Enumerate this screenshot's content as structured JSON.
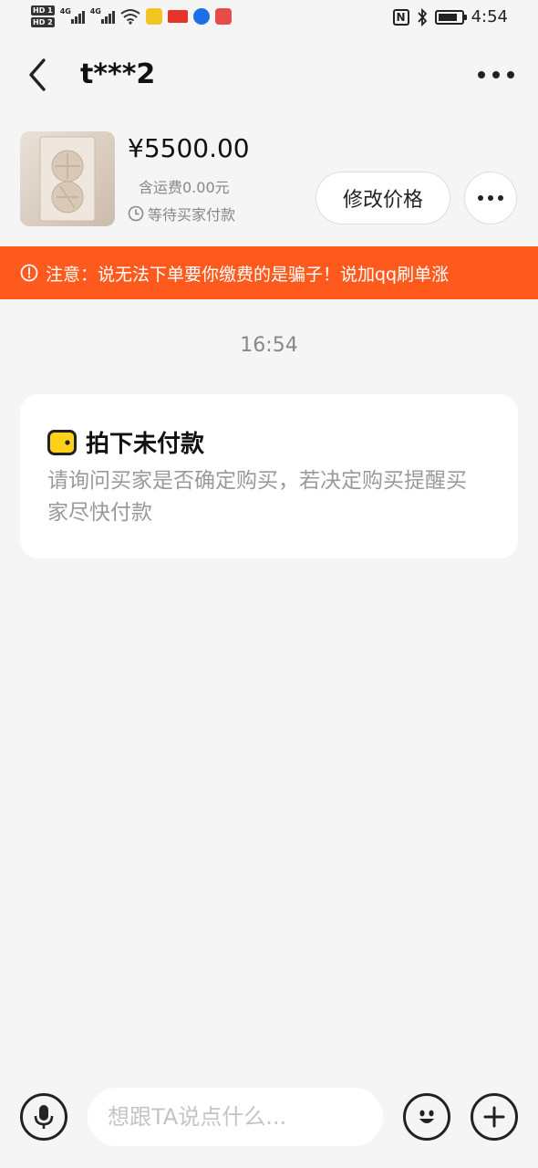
{
  "status_bar": {
    "hd1": "HD 1",
    "hd2": "HD 2",
    "net1": "4G",
    "net2": "4G",
    "nfc": "N",
    "time": "4:54"
  },
  "header": {
    "title": "t***2"
  },
  "product": {
    "price": "¥5500.00",
    "shipping": "含运费0.00元",
    "status": "等待买家付款",
    "edit_price_label": "修改价格"
  },
  "warning": {
    "text": "注意：说无法下单要你缴费的是骗子！说加qq刷单涨"
  },
  "chat": {
    "timestamp": "16:54",
    "card": {
      "title": "拍下未付款",
      "body": "请询问买家是否确定购买，若决定购买提醒买家尽快付款"
    }
  },
  "input": {
    "placeholder": "想跟TA说点什么..."
  },
  "colors": {
    "warning_bg": "#ff5a1e",
    "wallet_icon": "#ffd21a"
  }
}
